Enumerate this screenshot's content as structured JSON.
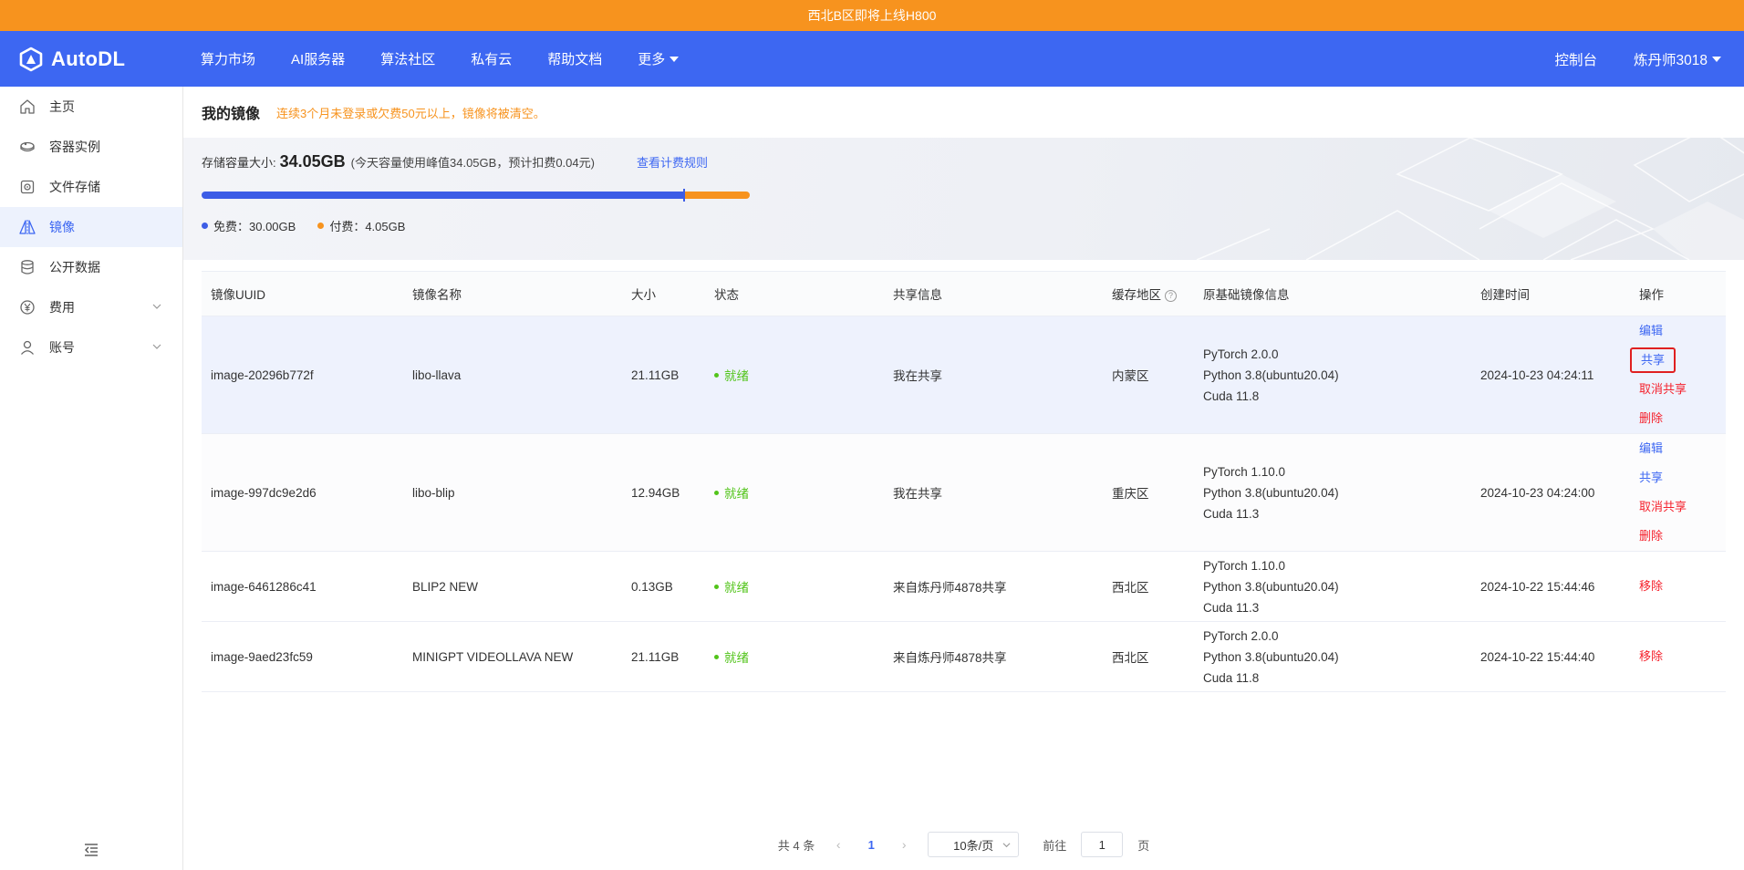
{
  "banner": {
    "text": "西北B区即将上线H800"
  },
  "topnav": {
    "logo_text": "AutoDL",
    "items": [
      {
        "label": "算力市场"
      },
      {
        "label": "AI服务器"
      },
      {
        "label": "算法社区"
      },
      {
        "label": "私有云"
      },
      {
        "label": "帮助文档"
      },
      {
        "label": "更多"
      }
    ],
    "console_label": "控制台",
    "user_label": "炼丹师3018"
  },
  "sidebar": {
    "items": [
      {
        "label": "主页",
        "icon": "home-icon"
      },
      {
        "label": "容器实例",
        "icon": "container-icon"
      },
      {
        "label": "文件存储",
        "icon": "storage-icon"
      },
      {
        "label": "镜像",
        "icon": "image-icon",
        "active": true
      },
      {
        "label": "公开数据",
        "icon": "database-icon"
      },
      {
        "label": "费用",
        "icon": "yen-icon",
        "expandable": true
      },
      {
        "label": "账号",
        "icon": "user-icon",
        "expandable": true
      }
    ]
  },
  "page": {
    "title": "我的镜像",
    "warning": "连续3个月未登录或欠费50元以上，镜像将被清空。"
  },
  "storage": {
    "label": "存储容量大小:",
    "value": "34.05GB",
    "note": "(今天容量使用峰值34.05GB，预计扣费0.04元)",
    "link": "查看计费规则",
    "free_label": "免费：30.00GB",
    "paid_label": "付费：4.05GB",
    "free_fraction": 0.881,
    "colors": {
      "free": "#3d5de6",
      "paid": "#f7931e"
    }
  },
  "table": {
    "headers": [
      "镜像UUID",
      "镜像名称",
      "大小",
      "状态",
      "共享信息",
      "缓存地区",
      "原基础镜像信息",
      "创建时间",
      "操作"
    ],
    "rows": [
      {
        "uuid": "image-20296b772f",
        "name": "libo-llava",
        "size": "21.11GB",
        "status": "就绪",
        "share": "我在共享",
        "region": "内蒙区",
        "base": [
          "PyTorch  2.0.0",
          "Python  3.8(ubuntu20.04)",
          "Cuda  11.8"
        ],
        "created": "2024-10-23 04:24:11",
        "ops": [
          "编辑",
          "共享",
          "取消共享",
          "删除"
        ]
      },
      {
        "uuid": "image-997dc9e2d6",
        "name": "libo-blip",
        "size": "12.94GB",
        "status": "就绪",
        "share": "我在共享",
        "region": "重庆区",
        "base": [
          "PyTorch  1.10.0",
          "Python  3.8(ubuntu20.04)",
          "Cuda  11.3"
        ],
        "created": "2024-10-23 04:24:00",
        "ops": [
          "编辑",
          "共享",
          "取消共享",
          "删除"
        ]
      },
      {
        "uuid": "image-6461286c41",
        "name": "BLIP2 NEW",
        "size": "0.13GB",
        "status": "就绪",
        "share": "来自炼丹师4878共享",
        "region": "西北区",
        "base": [
          "PyTorch  1.10.0",
          "Python  3.8(ubuntu20.04)",
          "Cuda  11.3"
        ],
        "created": "2024-10-22 15:44:46",
        "ops": [
          "移除"
        ]
      },
      {
        "uuid": "image-9aed23fc59",
        "name": "MINIGPT VIDEOLLAVA NEW",
        "size": "21.11GB",
        "status": "就绪",
        "share": "来自炼丹师4878共享",
        "region": "西北区",
        "base": [
          "PyTorch  2.0.0",
          "Python  3.8(ubuntu20.04)",
          "Cuda  11.8"
        ],
        "created": "2024-10-22 15:44:40",
        "ops": [
          "移除"
        ]
      }
    ]
  },
  "pager": {
    "total": "共 4 条",
    "current": "1",
    "page_size": "10条/页",
    "goto_label": "前往",
    "goto_value": "1",
    "page_unit": "页"
  }
}
